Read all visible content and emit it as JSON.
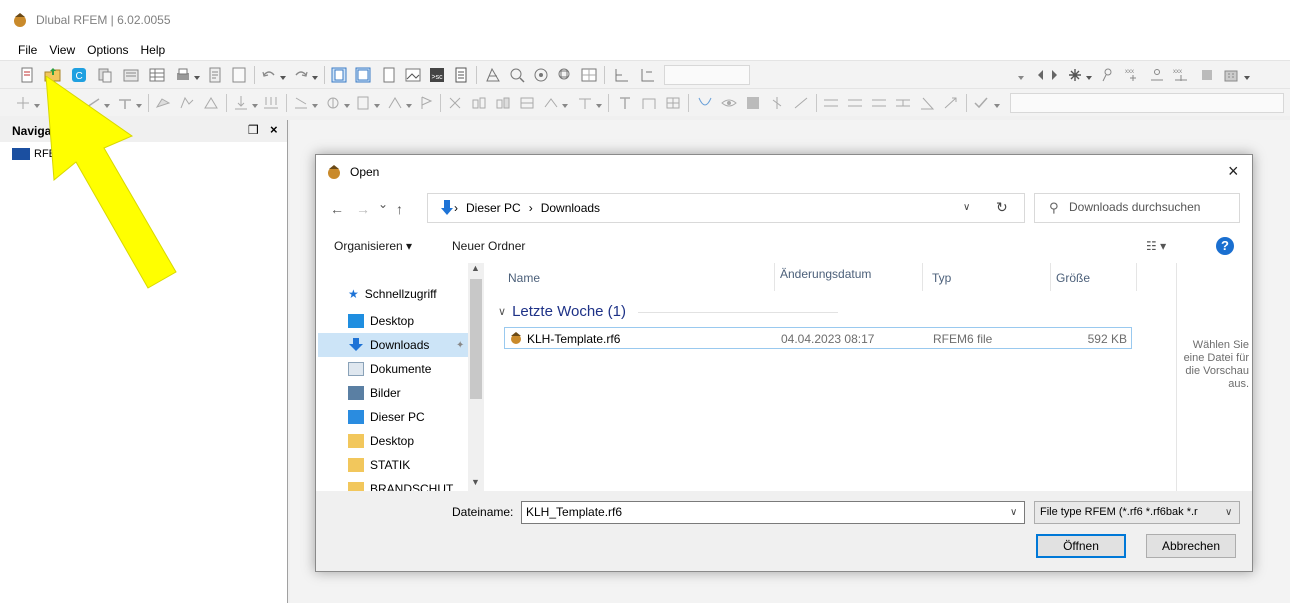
{
  "app": {
    "title": "Dlubal RFEM | 6.02.0055",
    "menu": [
      "File",
      "View",
      "Options",
      "Help"
    ]
  },
  "navigator": {
    "title": "Navigator",
    "pin": "❒",
    "close": "×",
    "root_label": "RFEM"
  },
  "dialog": {
    "title": "Open",
    "close": "×",
    "nav": {
      "back": "←",
      "forward": "→",
      "recent": "⌄",
      "up": "↑"
    },
    "breadcrumb": [
      "Dieser PC",
      "Downloads"
    ],
    "breadcrumb_sep": "›",
    "search_placeholder": "Downloads durchsuchen",
    "commands": {
      "organize": "Organisieren ▾",
      "new_folder": "Neuer Ordner",
      "view": "☷ ▾",
      "help": "?"
    },
    "sidebar": {
      "quick_access": "Schnellzugriff",
      "items": [
        {
          "label": "Desktop",
          "color": "#1f8ee0"
        },
        {
          "label": "Downloads",
          "color": "#1e73d6",
          "selected": true
        },
        {
          "label": "Dokumente",
          "color": "#8aa2b8"
        },
        {
          "label": "Bilder",
          "color": "#5a7fa3"
        },
        {
          "label": "Dieser PC",
          "color": "#2a8ce0"
        },
        {
          "label": "Desktop",
          "color": "#f2c75c"
        },
        {
          "label": "STATIK",
          "color": "#f2c75c"
        },
        {
          "label": "BRANDSCHUT",
          "color": "#f2c75c"
        }
      ]
    },
    "columns": [
      "Name",
      "Änderungsdatum",
      "Typ",
      "Größe"
    ],
    "group": {
      "label": "Letzte Woche (1)",
      "toggle": "∨"
    },
    "files": [
      {
        "name": "KLH-Template.rf6",
        "date": "04.04.2023 08:17",
        "type": "RFEM6 file",
        "size": "592 KB"
      }
    ],
    "preview_message": "Wählen Sie eine Datei für die Vorschau aus.",
    "filename_label": "Dateiname:",
    "filename_value": "KLH_Template.rf6",
    "filetype_value": "File type RFEM (*.rf6 *.rf6bak *.r",
    "open_button": "Öffnen",
    "cancel_button": "Abbrechen"
  },
  "colors": {
    "accent": "#0078d7",
    "selection": "#cce4f7",
    "arrow": "#ffff00"
  }
}
